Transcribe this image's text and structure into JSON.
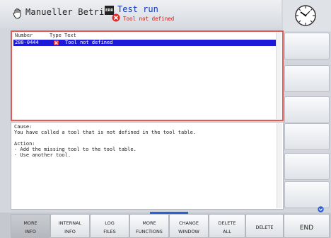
{
  "header": {
    "mode_label": "Manueller Betrieb",
    "badge_label": "ERR",
    "title": "Test run",
    "subtitle": "Tool not defined"
  },
  "error_list": {
    "columns": [
      "Number",
      "Type",
      "Text"
    ],
    "rows": [
      {
        "number": "280-0444",
        "type_icon": "error-x-icon",
        "text": "Tool not defined",
        "selected": true
      }
    ]
  },
  "details": {
    "cause_label": "Cause:",
    "cause_text": "You have called a tool that is not defined in the tool table.",
    "action_label": "Action:",
    "action_lines": [
      "- Add the missing tool to the tool table.",
      "- Use another tool."
    ]
  },
  "softkeys": [
    {
      "line1": "MORE",
      "line2": "INFO",
      "active": true
    },
    {
      "line1": "INTERNAL",
      "line2": "INFO"
    },
    {
      "line1": "LOG",
      "line2": "FILES"
    },
    {
      "line1": "MORE",
      "line2": "FUNCTIONS"
    },
    {
      "line1": "CHANGE",
      "line2": "WINDOW"
    },
    {
      "line1": "DELETE",
      "line2": "ALL"
    },
    {
      "line1": "DELETE",
      "line2": ""
    }
  ],
  "end_button": {
    "label": "END"
  },
  "colors": {
    "accent": "#1c1ad8",
    "error": "#d01818",
    "highlight_border": "#e05a5a"
  }
}
